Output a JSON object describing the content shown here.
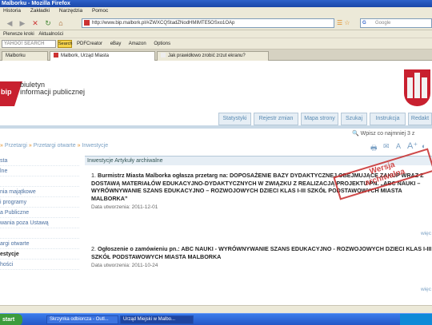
{
  "window": {
    "title": "Malborku - Mozilla Firefox"
  },
  "menu": [
    "Historia",
    "Zakładki",
    "Narzędzia",
    "Pomoc"
  ],
  "url": "http://www.bip.malbork.pl/#ZWXCQStadZNodHMIMTE5OSxo1OAp",
  "search_placeholder": "Google",
  "bookmarks": [
    "Pierwsze kroki",
    "Aktualności"
  ],
  "yahoo": {
    "box": "YAHOO! SEARCH",
    "search_btn": "Search",
    "items": [
      "PDFCreator",
      "eBay",
      "Amazon",
      "Options"
    ]
  },
  "tabs": [
    "Malborku",
    "Malbork, Urząd Miasta",
    "Jak prawidłowo zrobić zrzut ekranu?"
  ],
  "logo": {
    "mark": "bip",
    "line1": "biuletyn",
    "line2": "informacji publicznej"
  },
  "nav": [
    "Statystyki",
    "Rejestr zmian",
    "Mapa strony",
    "Szukaj",
    "Instrukcja",
    "Redakt"
  ],
  "site_search": "Wpisz co najmniej 3 z",
  "breadcrumb": [
    "Przetargi",
    "Przetargi otwarte",
    "Inwestycje"
  ],
  "sidebar": [
    "sta",
    "lne",
    "",
    "nia majątkowe",
    "i programy",
    "a Publiczne",
    "wania poza Ustawą",
    "",
    "argi otwarte",
    "estycje",
    "hości"
  ],
  "panel_title": "Inwestycje Artykuły archiwalne",
  "articles": [
    {
      "num": "1.",
      "text": "Burmistrz Miasta Malborka ogłasza przetarg na: DOPOSAŻENIE BAZY DYDAKTYCZNEJ OBEJMUJĄCE ZAKUP WRAZ Z DOSTAWĄ MATERIAŁÓW EDUKACYJNO-DYDAKTYCZNYCH W ZWIĄZKU Z REALIZACJĄ PROJEKTU PN. „ABC NAUKI – WYRÓWNYWANIE SZANS EDUKACYJNO – ROZWOJOWYCH DZIECI KLAS I-III SZKÓŁ PODSTAWOWYCH MIASTA MALBORKA”",
      "date": "Data utworzenia: 2011-12-01"
    },
    {
      "num": "2.",
      "text": "Ogłoszenie o zamówieniu pn.: ABC NAUKI - WYRÓWNYWANIE SZANS EDUKACYJNO - ROZWOJOWYCH DZIECI KLAS I-III SZKÓŁ PODSTAWOWYCH MIASTA MALBORKA",
      "date": "Data utworzenia: 2011-10-24"
    }
  ],
  "more_label": "więc",
  "stamp": {
    "line1": "Wersja",
    "line2": "archiwalna"
  },
  "taskbar": {
    "start": "start",
    "items": [
      "Skrzynka odbiorcza - Outl...",
      "Urząd Miejski w Malbo..."
    ],
    "tray": ""
  }
}
